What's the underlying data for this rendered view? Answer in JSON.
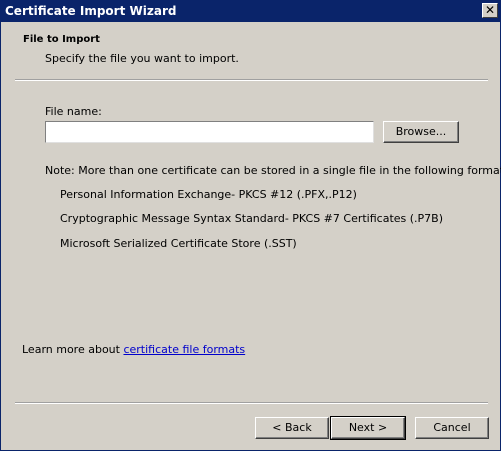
{
  "window": {
    "title": "Certificate Import Wizard",
    "close_glyph": "✕"
  },
  "header": {
    "title": "File to Import",
    "subtitle": "Specify the file you want to import."
  },
  "form": {
    "file_label": "File name:",
    "file_value": "",
    "browse_label": "Browse..."
  },
  "note": {
    "text": "Note:  More than one certificate can be stored in a single file in the following formats:",
    "formats": [
      "Personal Information Exchange- PKCS #12 (.PFX,.P12)",
      "Cryptographic Message Syntax Standard- PKCS #7 Certificates (.P7B)",
      "Microsoft Serialized Certificate Store (.SST)"
    ]
  },
  "learn_more": {
    "prefix": "Learn more about ",
    "link": "certificate file formats"
  },
  "footer": {
    "back_label": "< Back",
    "next_label": "Next >",
    "cancel_label": "Cancel"
  }
}
